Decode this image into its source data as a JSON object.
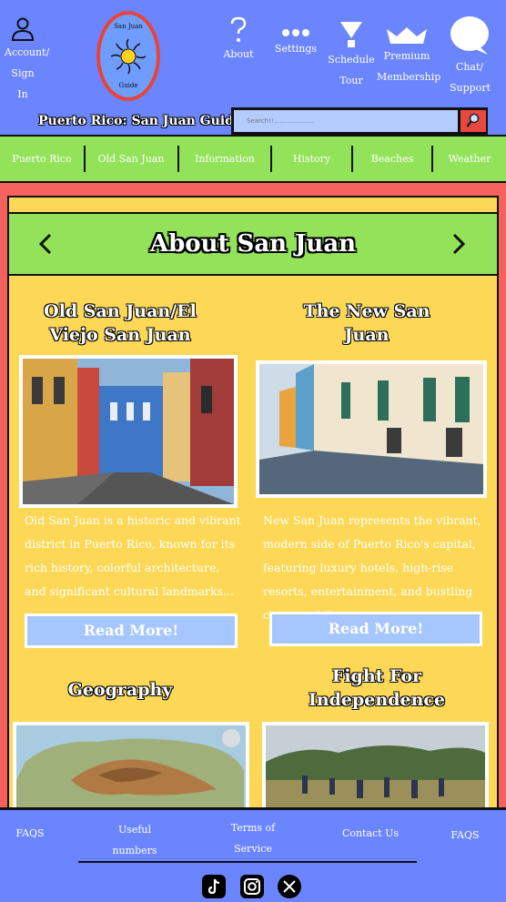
{
  "header": {
    "account_label": "Account/ Sign In",
    "about_label": "About",
    "settings_label": "Settings",
    "schedule_label": "Schedule Tour",
    "premium_label": "Premium Membership",
    "chat_label": "Chat/ Support",
    "site_title": "Puerto Rico: San Juan Guide",
    "logo_top": "San Juan",
    "logo_bottom": "Guide",
    "search_placeholder": "Search!!...................."
  },
  "nav": {
    "items": [
      "Puerto Rico",
      "Old San Juan",
      "Information",
      "History",
      "Beaches",
      "Weather"
    ]
  },
  "main": {
    "section_title": "About San Juan",
    "cards": [
      {
        "title": "Old San Juan/El Viejo San Juan",
        "text": "Old San Juan is a historic and vibrant district in Puerto Rico, known for its rich history, colorful architecture, and significant cultural landmarks...",
        "button": "Read More!"
      },
      {
        "title": "The New San Juan",
        "text": "New San Juan represents the vibrant, modern side of Puerto Rico's capital, featuring luxury hotels, high-rise resorts, entertainment, and bustling commercial...",
        "button": "Read More!"
      },
      {
        "title": "Geography"
      },
      {
        "title": "Fight For Independence"
      }
    ]
  },
  "footer": {
    "links": [
      "FAQS",
      "Useful numbers",
      "Terms of Service",
      "Contact Us",
      "FAQS"
    ],
    "socials": [
      "tiktok-icon",
      "instagram-icon",
      "x-icon"
    ]
  },
  "colors": {
    "header_blue": "#6b85ff",
    "nav_green": "#93e35a",
    "panel_yellow": "#fcd856",
    "main_red": "#f5625e",
    "button_blue": "#a6c6ff"
  }
}
